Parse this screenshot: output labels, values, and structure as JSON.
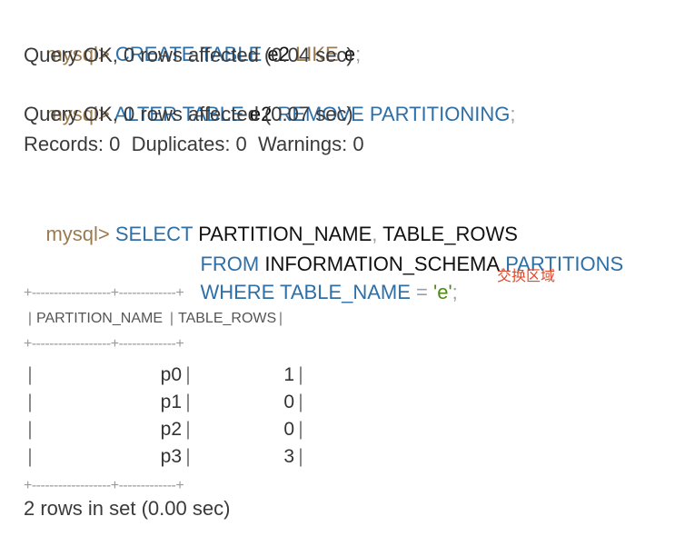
{
  "console": {
    "prompt": "mysql>",
    "lines": {
      "l1": {
        "kw1": "CREATE TABLE",
        "id1": "e2",
        "kw2": "LIKE",
        "id2": "e",
        "end": ";"
      },
      "l2": "Query OK, 0 rows affected (0.04 sec)",
      "l3": {
        "kw1": "ALTER TABLE",
        "id1": "e2",
        "kw2": "REMOVE PARTITIONING",
        "end": ";"
      },
      "l4": "Query OK, 0 rows affected (0.07 sec)",
      "l5": "Records: 0  Duplicates: 0  Warnings: 0",
      "l6": {
        "kw1": "SELECT",
        "id1": "PARTITION_NAME",
        "sep": ",",
        "id2": "TABLE_ROWS"
      },
      "l7": {
        "kw1": "FROM",
        "id1": "INFORMATION_SCHEMA",
        "dot": ".",
        "kw2": "PARTITIONS"
      },
      "l8": {
        "kw1": "WHERE TABLE_NAME",
        "eq": "=",
        "str": "'e'",
        "end": ";"
      },
      "footer": "2 rows in set (0.00 sec)"
    },
    "annotation": "交换区域",
    "table": {
      "border": "+------------------+-------------+",
      "headers": [
        "PARTITION_NAME",
        "TABLE_ROWS"
      ],
      "rows": [
        {
          "name": "p0",
          "rows": "1"
        },
        {
          "name": "p1",
          "rows": "0"
        },
        {
          "name": "p2",
          "rows": "0"
        },
        {
          "name": "p3",
          "rows": "3"
        }
      ]
    }
  }
}
